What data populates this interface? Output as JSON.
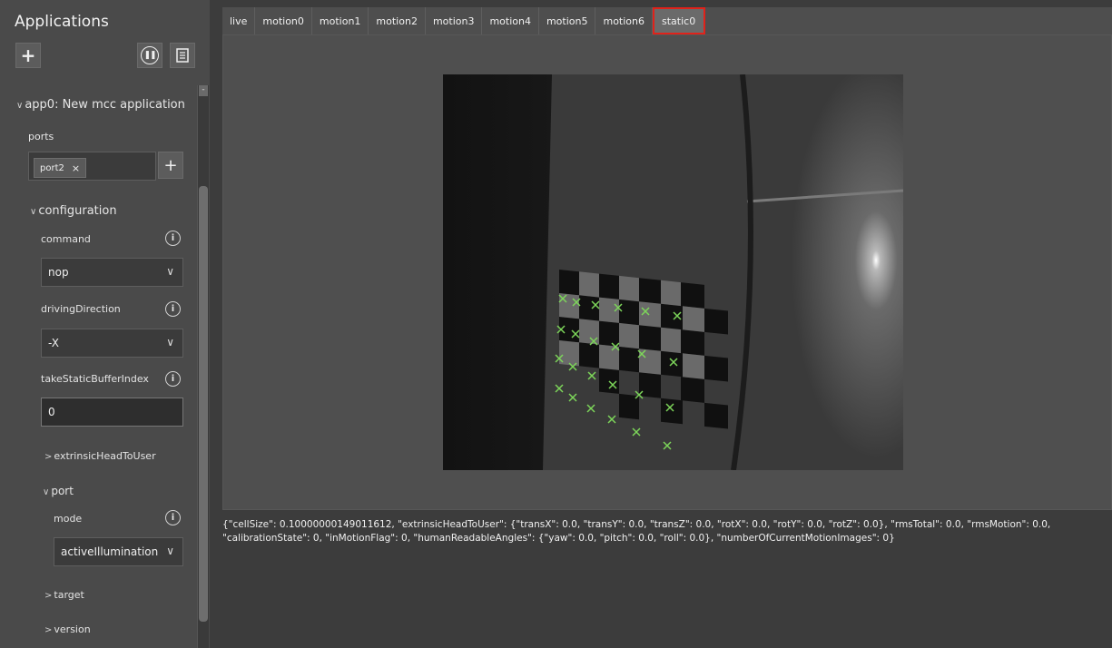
{
  "sidebar": {
    "title": "Applications",
    "add_icon": "plus-icon",
    "pause_icon": "pause-circle-icon",
    "save_icon": "save-icon",
    "app_node": "app0: New mcc application",
    "ports_label": "ports",
    "port_chip": "port2",
    "port_chip_remove": "×",
    "configuration_label": "configuration",
    "command_label": "command",
    "command_value": "nop",
    "driving_direction_label": "drivingDirection",
    "driving_direction_value": "-X",
    "take_static_label": "takeStaticBufferIndex",
    "take_static_value": "0",
    "extrinsic_label": "extrinsicHeadToUser",
    "port_node_label": "port",
    "mode_label": "mode",
    "mode_value": "activeIllumination",
    "target_label": "target",
    "version_label": "version"
  },
  "tabs": [
    {
      "label": "live"
    },
    {
      "label": "motion0"
    },
    {
      "label": "motion1"
    },
    {
      "label": "motion2"
    },
    {
      "label": "motion3"
    },
    {
      "label": "motion4"
    },
    {
      "label": "motion5"
    },
    {
      "label": "motion6"
    },
    {
      "label": "static0",
      "active": true
    }
  ],
  "colors": {
    "active_tab_outline": "#e0221a",
    "marker": "#7dd65a"
  },
  "output_text": "{\"cellSize\": 0.10000000149011612, \"extrinsicHeadToUser\": {\"transX\": 0.0, \"transY\": 0.0, \"transZ\": 0.0, \"rotX\": 0.0, \"rotY\": 0.0, \"rotZ\": 0.0}, \"rmsTotal\": 0.0, \"rmsMotion\": 0.0, \"calibrationState\": 0, \"inMotionFlag\": 0, \"humanReadableAngles\": {\"yaw\": 0.0, \"pitch\": 0.0, \"roll\": 0.0}, \"numberOfCurrentMotionImages\": 0}"
}
